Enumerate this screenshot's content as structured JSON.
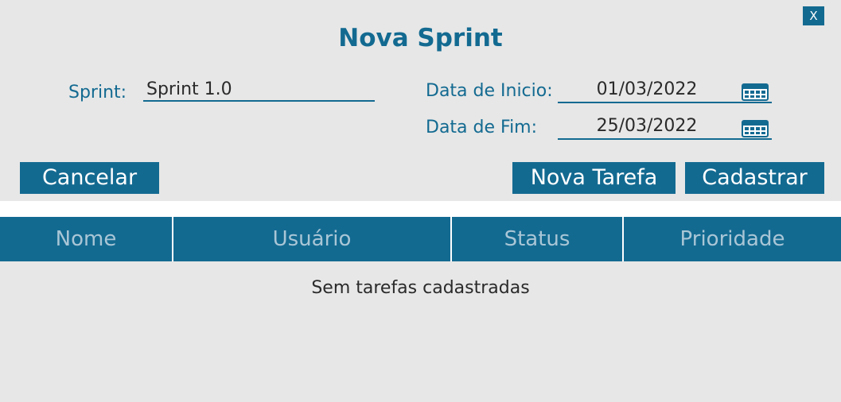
{
  "dialog": {
    "close_label": "X",
    "title": "Nova Sprint"
  },
  "form": {
    "sprint_label": "Sprint:",
    "sprint_value": "Sprint 1.0",
    "start_date_label": "Data de Inicio:",
    "start_date_value": "01/03/2022",
    "end_date_label": "Data de Fim:",
    "end_date_value": "25/03/2022"
  },
  "actions": {
    "cancel_label": "Cancelar",
    "new_task_label": "Nova Tarefa",
    "submit_label": "Cadastrar"
  },
  "table": {
    "columns": [
      "Nome",
      "Usuário",
      "Status",
      "Prioridade"
    ],
    "empty_message": "Sem tarefas cadastradas"
  },
  "icons": {
    "close": "close-icon",
    "calendar": "calendar-icon"
  },
  "colors": {
    "accent": "#136a91",
    "background": "#e7e7e7",
    "header_text": "#a9c6d6"
  }
}
